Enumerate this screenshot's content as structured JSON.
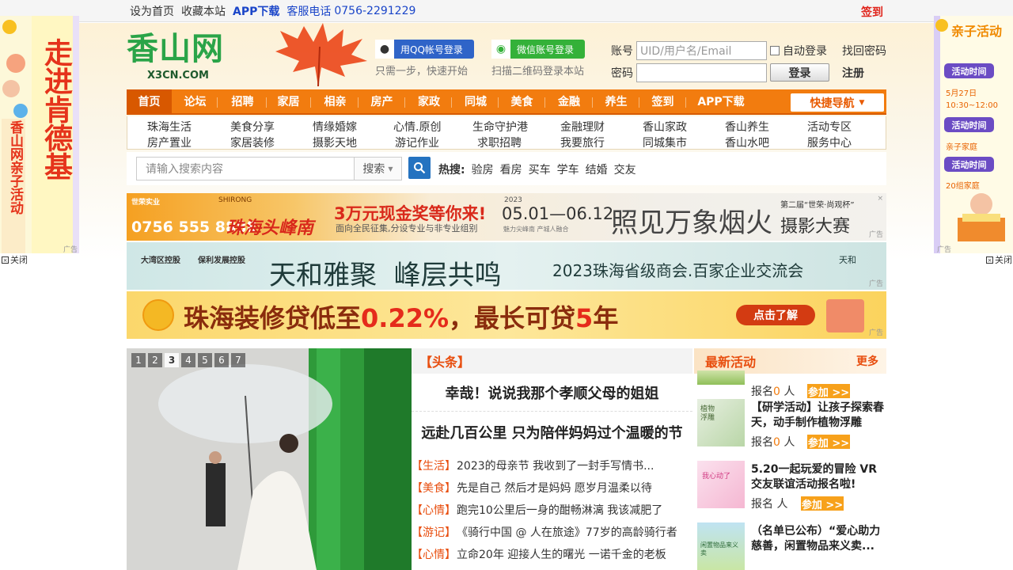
{
  "topbar": {
    "links": [
      "设为首页",
      "收藏本站"
    ],
    "app_download": "APP下载",
    "hotline_label": "客服电话",
    "hotline": "0756-2291229",
    "signin": "签到"
  },
  "logo": {
    "cn": "香山网",
    "en": "X3CN.COM"
  },
  "login": {
    "qq_button": "用QQ帐号登录",
    "qq_hint": "只需一步，快速开始",
    "wechat_button": "微信账号登录",
    "wechat_hint": "扫描二维码登录本站",
    "account_label": "账号",
    "account_placeholder": "UID/用户名/Email",
    "password_label": "密码",
    "auto_login": "自动登录",
    "find_password": "找回密码",
    "login_button": "登录",
    "register": "注册"
  },
  "nav": {
    "items": [
      "首页",
      "论坛",
      "招聘",
      "家居",
      "相亲",
      "房产",
      "家政",
      "同城",
      "美食",
      "金融",
      "养生",
      "签到",
      "APP下载"
    ],
    "quick": "快捷导航"
  },
  "subnav": {
    "row1": [
      "珠海生活",
      "美食分享",
      "情缘婚嫁",
      "心情.原创",
      "生命守护港",
      "金融理财",
      "香山家政",
      "香山养生",
      "活动专区"
    ],
    "row2": [
      "房产置业",
      "家居装修",
      "摄影天地",
      "游记作业",
      "求职招聘",
      "我要旅行",
      "同城集市",
      "香山水吧",
      "服务中心"
    ]
  },
  "search": {
    "placeholder": "请输入搜索内容",
    "select": "搜索",
    "hot_label": "热搜:",
    "hot_words": [
      "验房",
      "看房",
      "买车",
      "学车",
      "结婚",
      "交友"
    ]
  },
  "ads": {
    "ad1": {
      "brand": "世荣实业",
      "badge": "SHIRONG",
      "tel": "0756 555 8888",
      "slogan": "珠海头峰南",
      "prize": "3万元现金奖等你来!",
      "prize_sub": "面向全民征集,分设专业与非专业组别",
      "date_year": "2023",
      "dates": "05.01—06.12",
      "date_sub": "魅力尖峰南  产城人融合",
      "headline": "照见万象烟火",
      "contest_title": "第二届“世荣·尚观杯”",
      "contest": "摄影大赛",
      "tag": "广告"
    },
    "ad2": {
      "brands": [
        "大湾区控股",
        "保利发展控股"
      ],
      "headline": "天和雅聚  峰层共鸣",
      "sub": "2023珠海省级商会.百家企业交流会",
      "logo": "天和",
      "tag": "广告"
    },
    "ad3": {
      "headline_a": "珠海装修贷低至",
      "headline_rate": "0.22%",
      "headline_b": "，最长可贷",
      "headline_years": "5",
      "headline_c": "年",
      "cta": "点击了解",
      "tag": "广告"
    }
  },
  "side_left": {
    "title": "走进肯德基",
    "sub": "香山网亲子活动",
    "tag": "广告",
    "close": "关闭"
  },
  "side_right": {
    "title": "亲子活动",
    "button": "活动时间",
    "info1_date": "5月27日",
    "info1_time": "10:30~12:00",
    "info2": "亲子家庭",
    "info3": "20组家庭",
    "tag": "广告",
    "close": "关闭"
  },
  "slider": {
    "pages": [
      "1",
      "2",
      "3",
      "4",
      "5",
      "6",
      "7"
    ],
    "active": "3"
  },
  "news": {
    "header": "【头条】",
    "headline1": "幸哉！说说我那个孝顺父母的姐姐",
    "headline2": "远赴几百公里 只为陪伴妈妈过个温暖的节",
    "items": [
      {
        "tag": "【生活】",
        "title": "2023的母亲节 我收到了一封手写情书..."
      },
      {
        "tag": "【美食】",
        "title": "先是自己 然后才是妈妈 愿岁月温柔以待"
      },
      {
        "tag": "【心情】",
        "title": "跑完10公里后一身的酣畅淋漓 我该减肥了"
      },
      {
        "tag": "【游记】",
        "title": "《骑行中国 @ 人在旅途》77岁的高龄骑行者"
      },
      {
        "tag": "【心情】",
        "title": "立命20年 迎接人生的曙光 一诺千金的老板"
      }
    ]
  },
  "activities": {
    "title": "最新活动",
    "more": "更多",
    "items": [
      {
        "title": "",
        "reg_label": "报名",
        "count": "0",
        "unit": "人",
        "join": "参加 >>"
      },
      {
        "title": "【研学活动】让孩子探索春天，动手制作植物浮雕",
        "reg_label": "报名",
        "count": "0",
        "unit": "人",
        "join": "参加 >>",
        "thumb_text": "植物浮雕"
      },
      {
        "title": "5.20一起玩爱的冒险 VR交友联谊活动报名啦!",
        "reg_label": "报名",
        "count": "",
        "unit": "人",
        "join": "参加 >>",
        "thumb_text": "我心动了"
      },
      {
        "title": "（名单已公布）“爱心助力慈善，闲置物品来义卖...",
        "reg_label": "",
        "count": "",
        "unit": "",
        "join": "",
        "thumb_text": "闲置物品来义卖"
      }
    ]
  }
}
